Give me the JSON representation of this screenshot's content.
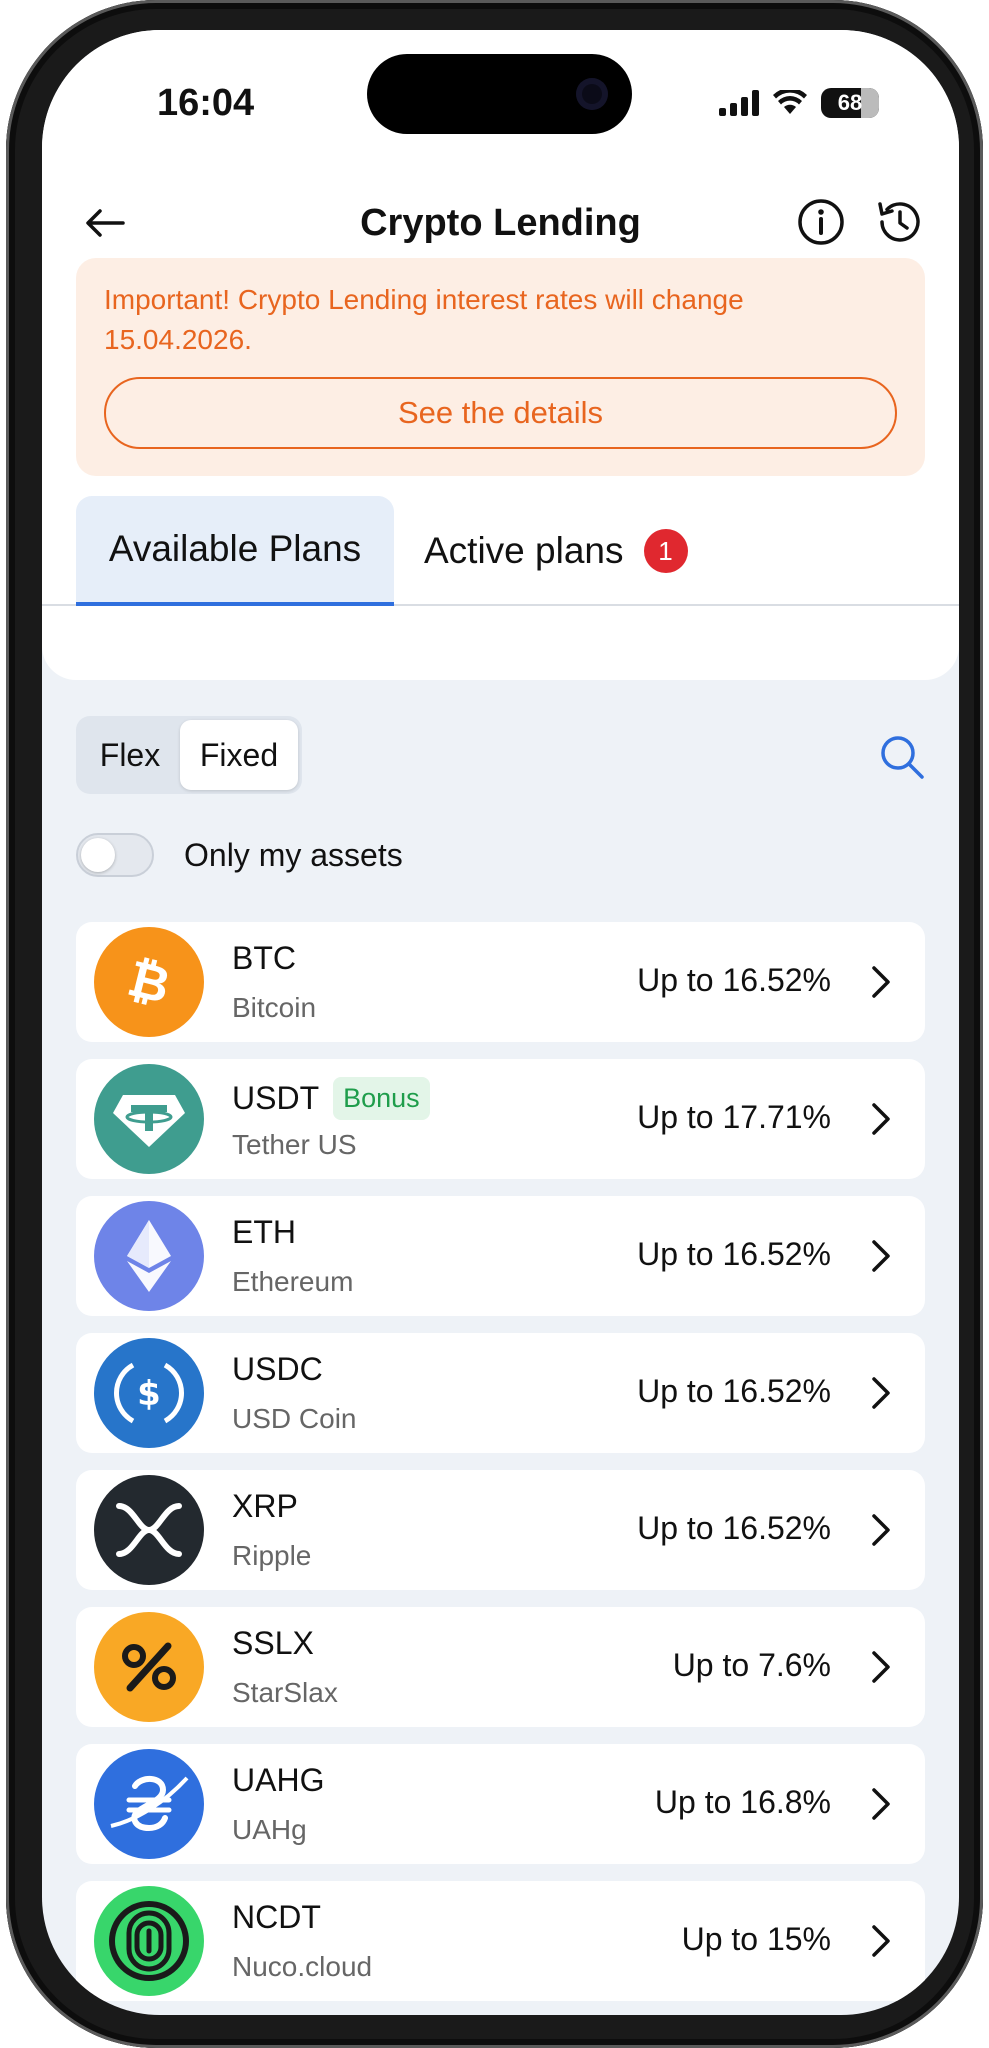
{
  "status": {
    "time": "16:04",
    "battery": "68"
  },
  "header": {
    "title": "Crypto Lending"
  },
  "notice": {
    "text": "Important! Crypto Lending interest rates will change 15.04.2026.",
    "button": "See the details"
  },
  "tabs": {
    "available": "Available Plans",
    "active": "Active plans",
    "active_count": "1"
  },
  "filter": {
    "flex": "Flex",
    "fixed": "Fixed",
    "selected": "Fixed"
  },
  "toggle": {
    "label": "Only my assets",
    "on": false
  },
  "assets": [
    {
      "ticker": "BTC",
      "name": "Bitcoin",
      "rate": "Up to 16.52%",
      "bonus": "",
      "icon": "bitcoin-icon",
      "color": "#f7931a"
    },
    {
      "ticker": "USDT",
      "name": "Tether US",
      "rate": "Up to 17.71%",
      "bonus": "Bonus",
      "icon": "tether-icon",
      "color": "#3f9d8f"
    },
    {
      "ticker": "ETH",
      "name": "Ethereum",
      "rate": "Up to 16.52%",
      "bonus": "",
      "icon": "ethereum-icon",
      "color": "#6e84e8"
    },
    {
      "ticker": "USDC",
      "name": "USD Coin",
      "rate": "Up to 16.52%",
      "bonus": "",
      "icon": "usdc-icon",
      "color": "#2775ca"
    },
    {
      "ticker": "XRP",
      "name": "Ripple",
      "rate": "Up to 16.52%",
      "bonus": "",
      "icon": "xrp-icon",
      "color": "#23292f"
    },
    {
      "ticker": "SSLX",
      "name": "StarSlax",
      "rate": "Up to 7.6%",
      "bonus": "",
      "icon": "starslax-icon",
      "color": "#f9a825"
    },
    {
      "ticker": "UAHG",
      "name": "UAHg",
      "rate": "Up to 16.8%",
      "bonus": "",
      "icon": "uahg-icon",
      "color": "#2f6fde"
    },
    {
      "ticker": "NCDT",
      "name": "Nuco.cloud",
      "rate": "Up to 15%",
      "bonus": "",
      "icon": "nuco-icon",
      "color": "#38d66b"
    }
  ],
  "colors": {
    "accent": "#2f6fde",
    "warning": "#e8651f",
    "badge": "#e0282f",
    "bonus": "#1f9d4b"
  }
}
